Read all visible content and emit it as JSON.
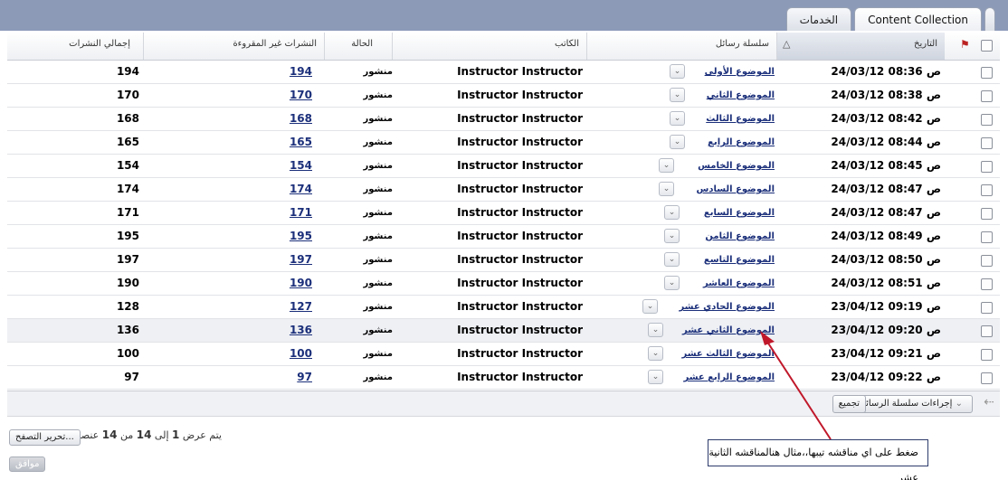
{
  "tabs": [
    {
      "label": "Content Collection",
      "active": true
    },
    {
      "label": "الخدمات",
      "active": false
    }
  ],
  "columns": {
    "date": "التاريخ",
    "thread": "سلسلة رسائل",
    "author": "الكاتب",
    "status": "الحالة",
    "unread": "النشرات غير المقروءة",
    "total": "إجمالي النشرات"
  },
  "rows": [
    {
      "date": "24/03/12 08:36 ص",
      "thread": "الموضوع الأولى",
      "author": "Instructor Instructor",
      "status": "منشور",
      "unread": "194",
      "total": "194"
    },
    {
      "date": "24/03/12 08:38 ص",
      "thread": "الموضوع الثاني",
      "author": "Instructor Instructor",
      "status": "منشور",
      "unread": "170",
      "total": "170"
    },
    {
      "date": "24/03/12 08:42 ص",
      "thread": "الموضوع الثالث",
      "author": "Instructor Instructor",
      "status": "منشور",
      "unread": "168",
      "total": "168"
    },
    {
      "date": "24/03/12 08:44 ص",
      "thread": "الموضوع الرابع",
      "author": "Instructor Instructor",
      "status": "منشور",
      "unread": "165",
      "total": "165"
    },
    {
      "date": "24/03/12 08:45 ص",
      "thread": "الموضوع الخامس",
      "author": "Instructor Instructor",
      "status": "منشور",
      "unread": "154",
      "total": "154"
    },
    {
      "date": "24/03/12 08:47 ص",
      "thread": "الموضوع السادس",
      "author": "Instructor Instructor",
      "status": "منشور",
      "unread": "174",
      "total": "174"
    },
    {
      "date": "24/03/12 08:47 ص",
      "thread": "الموضوع السابع",
      "author": "Instructor Instructor",
      "status": "منشور",
      "unread": "171",
      "total": "171"
    },
    {
      "date": "24/03/12 08:49 ص",
      "thread": "الموضوع الثامن",
      "author": "Instructor Instructor",
      "status": "منشور",
      "unread": "195",
      "total": "195"
    },
    {
      "date": "24/03/12 08:50 ص",
      "thread": "الموضوع التاسع",
      "author": "Instructor Instructor",
      "status": "منشور",
      "unread": "197",
      "total": "197"
    },
    {
      "date": "24/03/12 08:51 ص",
      "thread": "الموضوع العاشر",
      "author": "Instructor Instructor",
      "status": "منشور",
      "unread": "190",
      "total": "190"
    },
    {
      "date": "23/04/12 09:19 ص",
      "thread": "الموضوع الحادي عشر",
      "author": "Instructor Instructor",
      "status": "منشور",
      "unread": "127",
      "total": "128"
    },
    {
      "date": "23/04/12 09:20 ص",
      "thread": "الموضوع الثاني عشر",
      "author": "Instructor Instructor",
      "status": "منشور",
      "unread": "136",
      "total": "136"
    },
    {
      "date": "23/04/12 09:21 ص",
      "thread": "الموضوع الثالث عشر",
      "author": "Instructor Instructor",
      "status": "منشور",
      "unread": "100",
      "total": "100"
    },
    {
      "date": "23/04/12 09:22 ص",
      "thread": "الموضوع الرابع عشر",
      "author": "Instructor Instructor",
      "status": "منشور",
      "unread": "97",
      "total": "97"
    }
  ],
  "actions": {
    "thread_actions": "إجراءات سلسلة الرسائل",
    "collect": "تجميع"
  },
  "footer": {
    "showing_prefix": "يتم عرض",
    "from": "1",
    "to_word": "إلى",
    "to": "14",
    "of_word": "من",
    "total": "14",
    "items_word": "عنصرًا",
    "edit_paging": "تحرير التصفح...",
    "ok": "موافق"
  },
  "callout": "ضغط على اي مناقشه تيبها،،مثال هنالمناقشه الثانية عشر",
  "colors": {
    "topbar": "#8c9ab8",
    "link": "#1b2f7a",
    "arrow": "#c0182a"
  }
}
